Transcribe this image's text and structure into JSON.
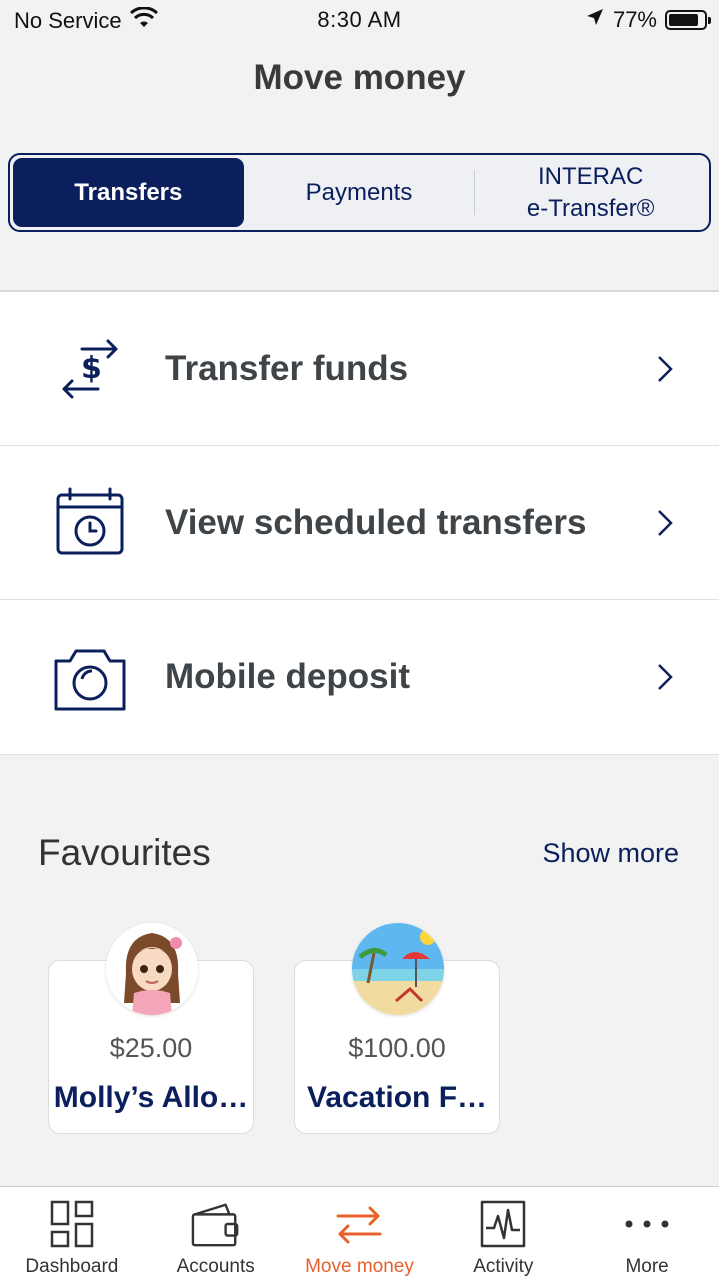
{
  "status_bar": {
    "carrier": "No Service",
    "time": "8:30 AM",
    "battery": "77%"
  },
  "header": {
    "title": "Move money"
  },
  "segments": [
    {
      "label": "Transfers",
      "active": true
    },
    {
      "label": "Payments",
      "active": false
    },
    {
      "label_line1": "INTERAC",
      "label_line2": "e-Transfer®",
      "active": false
    }
  ],
  "menu": [
    {
      "label": "Transfer funds",
      "icon": "transfer-dollar-icon"
    },
    {
      "label": "View scheduled transfers",
      "icon": "calendar-clock-icon"
    },
    {
      "label": "Mobile deposit",
      "icon": "camera-icon"
    }
  ],
  "favourites": {
    "title": "Favourites",
    "show_more": "Show more",
    "items": [
      {
        "amount": "$25.00",
        "name": "Molly’s Allo…",
        "avatar": "girl-avatar"
      },
      {
        "amount": "$100.00",
        "name": "Vacation F…",
        "avatar": "beach-avatar"
      }
    ]
  },
  "tabbar": [
    {
      "label": "Dashboard",
      "icon": "dashboard-icon",
      "active": false
    },
    {
      "label": "Accounts",
      "icon": "wallet-icon",
      "active": false
    },
    {
      "label": "Move money",
      "icon": "arrows-icon",
      "active": true
    },
    {
      "label": "Activity",
      "icon": "activity-icon",
      "active": false
    },
    {
      "label": "More",
      "icon": "more-dots-icon",
      "active": false
    }
  ],
  "colors": {
    "brand_navy": "#0b1f5c",
    "accent_orange": "#e8602c",
    "background": "#f2f2f2"
  }
}
